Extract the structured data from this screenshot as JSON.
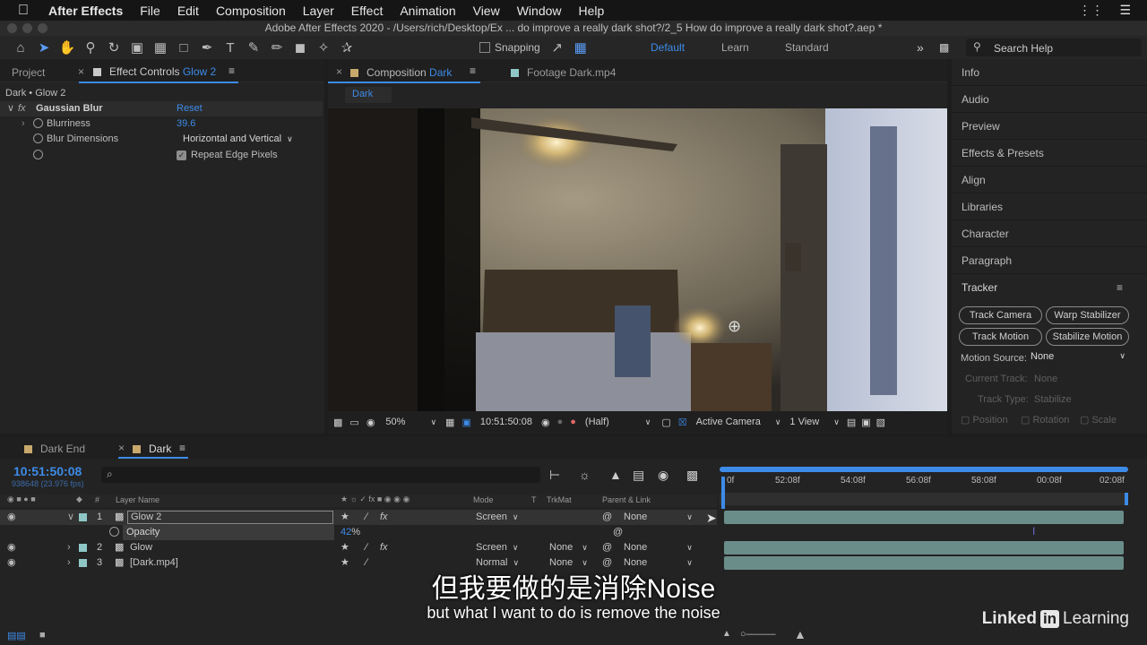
{
  "menubar": {
    "app": "After Effects",
    "items": [
      "File",
      "Edit",
      "Composition",
      "Layer",
      "Effect",
      "Animation",
      "View",
      "Window",
      "Help"
    ]
  },
  "title": "Adobe After Effects 2020 - /Users/rich/Desktop/Ex ... do improve a really dark shot?/2_5 How do improve a really dark shot?.aep *",
  "toolbar": {
    "snapping": "Snapping",
    "workspaces": [
      "Default",
      "Learn",
      "Standard"
    ],
    "active_workspace": "Default",
    "search_placeholder": "Search Help"
  },
  "effect_controls": {
    "project_tab": "Project",
    "tab_prefix": "Effect Controls",
    "tab_layer": "Glow 2",
    "header": "Dark • Glow 2",
    "effect_name": "Gaussian Blur",
    "reset": "Reset",
    "blurriness_label": "Blurriness",
    "blurriness_value": "39.6",
    "dimensions_label": "Blur Dimensions",
    "dimensions_value": "Horizontal and Vertical",
    "repeat_label": "Repeat Edge Pixels"
  },
  "composition": {
    "tab_prefix": "Composition",
    "tab_name": "Dark",
    "footage_tab": "Footage Dark.mp4",
    "crumb": "Dark",
    "zoom": "50%",
    "timecode": "10:51:50:08",
    "resolution": "(Half)",
    "camera": "Active Camera",
    "views": "1 View"
  },
  "right_panels": [
    "Info",
    "Audio",
    "Preview",
    "Effects & Presets",
    "Align",
    "Libraries",
    "Character",
    "Paragraph"
  ],
  "tracker": {
    "title": "Tracker",
    "buttons": [
      "Track Camera",
      "Warp Stabilizer",
      "Track Motion",
      "Stabilize Motion"
    ],
    "motion_source_label": "Motion Source:",
    "motion_source_value": "None",
    "current_track_label": "Current Track:",
    "current_track_value": "None",
    "track_type_label": "Track Type:",
    "track_type_value": "Stabilize",
    "position": "Position",
    "rotation": "Rotation",
    "scale": "Scale"
  },
  "timeline": {
    "tab1": "Dark End",
    "tab2": "Dark",
    "timecode": "10:51:50:08",
    "frames": "938648 (23.976 fps)",
    "search_placeholder": "⌕",
    "col_layer_name": "Layer Name",
    "col_mode": "Mode",
    "col_t": "T",
    "col_trkmat": "TrkMat",
    "col_parent": "Parent & Link",
    "ruler": [
      "0f",
      "52:08f",
      "54:08f",
      "56:08f",
      "58:08f",
      "00:08f",
      "02:08f"
    ],
    "layers": [
      {
        "num": "1",
        "name": "Glow 2",
        "mode": "Screen",
        "trkmat": "",
        "parent": "None"
      },
      {
        "num": "2",
        "name": "Glow",
        "mode": "Screen",
        "trkmat": "None",
        "parent": "None"
      },
      {
        "num": "3",
        "name": "[Dark.mp4]",
        "mode": "Normal",
        "trkmat": "None",
        "parent": "None"
      }
    ],
    "opacity_label": "Opacity",
    "opacity_value": "42",
    "opacity_unit": "%"
  },
  "subtitles": {
    "cn": "但我要做的是消除Noise",
    "en": "but what I want to do is remove the noise"
  },
  "logo": {
    "a": "Linked",
    "b": "in",
    "c": "Learning"
  }
}
